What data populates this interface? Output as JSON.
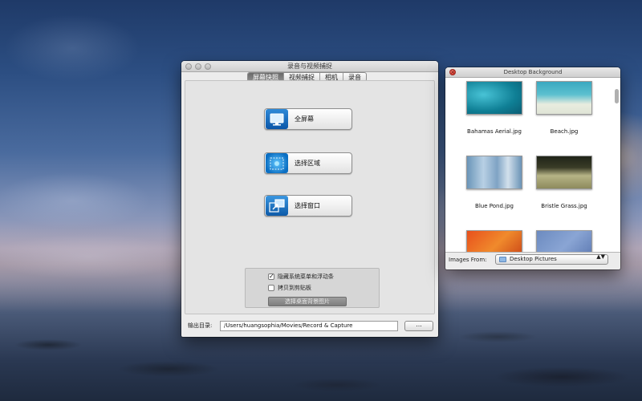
{
  "main_window": {
    "title": "录音与视频捕捉",
    "tabs": [
      {
        "label": "屏幕快照",
        "active": true
      },
      {
        "label": "视频捕捉",
        "active": false
      },
      {
        "label": "相机",
        "active": false
      },
      {
        "label": "录音",
        "active": false
      }
    ],
    "buttons": {
      "fullscreen": "全屏幕",
      "region": "选择区域",
      "window": "选择窗口"
    },
    "options": {
      "hide_menu_label": "隐藏系统菜单和浮动条",
      "hide_menu_checked": true,
      "hide_menu_mark": "✓",
      "copy_clipboard_label": "拷贝到剪贴板",
      "copy_clipboard_checked": false,
      "choose_bg_button": "选择桌面背景图片"
    },
    "output": {
      "label": "输出目录:",
      "path": "/Users/huangsophia/Movies/Record & Capture",
      "browse_label": "..."
    }
  },
  "desktop_window": {
    "title": "Desktop Background",
    "images": [
      {
        "name": "Bahamas Aerial.jpg"
      },
      {
        "name": "Beach.jpg"
      },
      {
        "name": "Blue Pond.jpg"
      },
      {
        "name": "Bristle Grass.jpg"
      }
    ],
    "images_from_label": "Images From:",
    "images_from_value": "Desktop Pictures",
    "popup_arrows": "▲▼"
  }
}
